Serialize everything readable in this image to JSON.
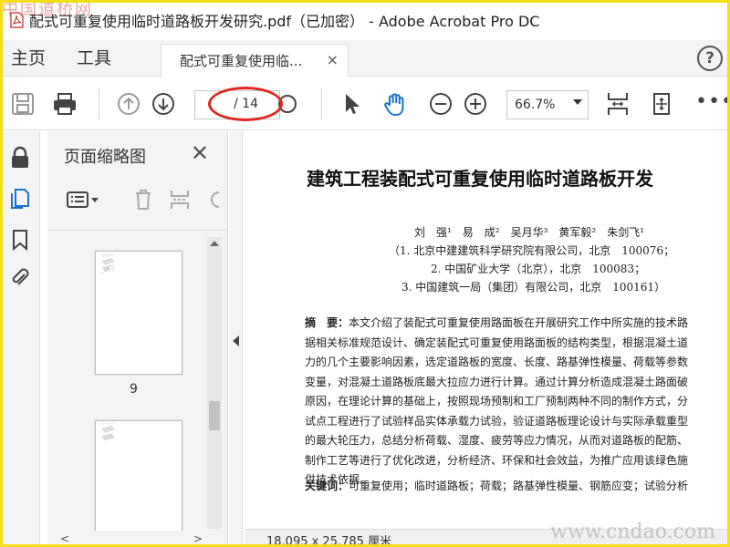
{
  "window": {
    "title": "配式可重复使用临时道路板开发研究.pdf（已加密） - Adobe Acrobat Pro DC"
  },
  "watermarks": {
    "top": "中国道桥网",
    "bottom": "www.cndao.com"
  },
  "tabs": {
    "home": "主页",
    "tools": "工具",
    "document": "配式可重复使用临...",
    "close": "×",
    "help": "?"
  },
  "toolbar": {
    "page_current": "",
    "page_total": "/ 14",
    "zoom": "66.7%",
    "more": "•••"
  },
  "icons": {
    "accent": "#1a73c9",
    "hand_color": "#1a73c9"
  },
  "thumbnail_panel": {
    "title": "页面缩略图",
    "close": "✕",
    "pages": [
      {
        "label": "9"
      }
    ]
  },
  "document": {
    "title": "建筑工程装配式可重复使用临时道路板开发",
    "authors": "刘　强¹　易　成²　吴月华³　黄军毅²　朱剑飞¹",
    "affiliations": [
      "（1. 北京中建建筑科学研究院有限公司，北京　100076；",
      "2. 中国矿业大学（北京），北京　100083；",
      "3. 中国建筑一局（集团）有限公司，北京　100161）"
    ],
    "abstract_lead": "摘　要：",
    "abstract_lines": [
      "本文介绍了装配式可重复使用路面板在开展研究工作中所实施的技术路",
      "据相关标准规范设计、确定装配式可重复使用路面板的结构类型，根据混凝土道",
      "力的几个主要影响因素，选定道路板的宽度、长度、路基弹性模量、荷载等参数",
      "变量，对混凝土道路板底最大拉应力进行计算。通过计算分析造成混凝土路面破",
      "原因，在理论计算的基础上，按照现场预制和工厂预制两种不同的制作方式，分",
      "试点工程进行了试验样品实体承载力试验，验证道路板理论设计与实际承载重型",
      "的最大轮压力，总结分析荷载、湿度、疲劳等应力情况，从而对道路板的配筋、",
      "制作工艺等进行了优化改进，分析经济、环保和社会效益，为推广应用该绿色施",
      "供技术依据。"
    ],
    "keywords_lead": "关键词：",
    "keywords": "可重复使用；临时道路板；荷载；路基弹性模量、钢筋应变；试验分析"
  },
  "status": {
    "page_size": "18.095 x 25.785 厘米"
  }
}
